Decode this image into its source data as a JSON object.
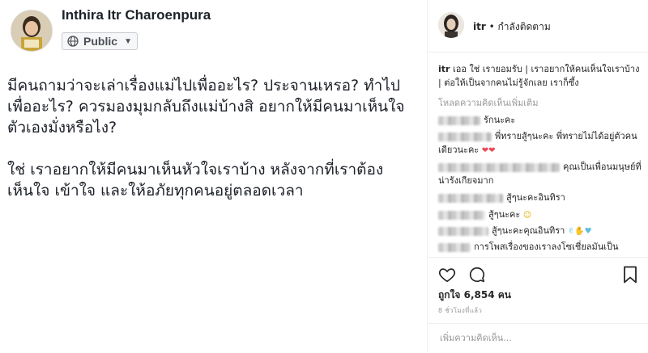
{
  "facebook": {
    "author_name": "Inthira Itr Charoenpura",
    "privacy_label": "Public",
    "paragraph_1": "มีคนถามว่าจะเล่าเรื่องแม่ไปเพื่ออะไร? ประจานเหรอ? ทำไปเพื่ออะไร? ควรมองมุมกลับถึงแม่บ้างสิ อยากให้มีคนมาเห็นใจตัวเองมั่งหรือไง?",
    "paragraph_2": "ใช่ เราอยากให้มีคนมาเห็นหัวใจเราบ้าง หลังจากที่เราต้องเห็นใจ เข้าใจ และให้อภัยทุกคนอยู่ตลอดเวลา"
  },
  "instagram": {
    "username": "itr",
    "follow_status": "• กำลังติดตาม",
    "caption_user": "itr",
    "caption_text": "เออ ใช่ เรายอมรับ | เราอยากให้คนเห็นใจเราบ้าง | ต่อให้เป็นจากคนไม่รู้จักเลย เราก็ซึ้ง",
    "load_more_comments": "โหลดความคิดเห็นเพิ่มเติม",
    "comments": [
      {
        "text": "รักนะคะ",
        "emoji": ""
      },
      {
        "text": "พี่ทรายสู้ๆนะคะ พี่ทรายไม่ได้อยู่ตัวคนเดียวนะคะ",
        "emoji": "❤❤"
      },
      {
        "text": "คุณเป็นเพื่อนมนุษย์ที่น่ารังเกียจมาก",
        "emoji": ""
      },
      {
        "text": "สู้ๆนะคะอินทิรา",
        "emoji": ""
      },
      {
        "text": "สู้ๆนะคะ",
        "emoji": "☺"
      },
      {
        "text": "สู้ๆนะคะคุณอินทิรา",
        "emoji": "✌✋♥"
      },
      {
        "text": "การโพสเรื่องของเราลงโซเชี่ยลมันเป็น",
        "emoji": ""
      }
    ],
    "likes_text": "ถูกใจ 6,854 คน",
    "timestamp": "8 ชั่วโมงที่แล้ว",
    "add_comment_placeholder": "เพิ่มความคิดเห็น..."
  },
  "colors": {
    "heart_emoji": "#ed4956",
    "blue_heart": "#5bc0de",
    "muted_text": "#999999",
    "text": "#262626"
  }
}
